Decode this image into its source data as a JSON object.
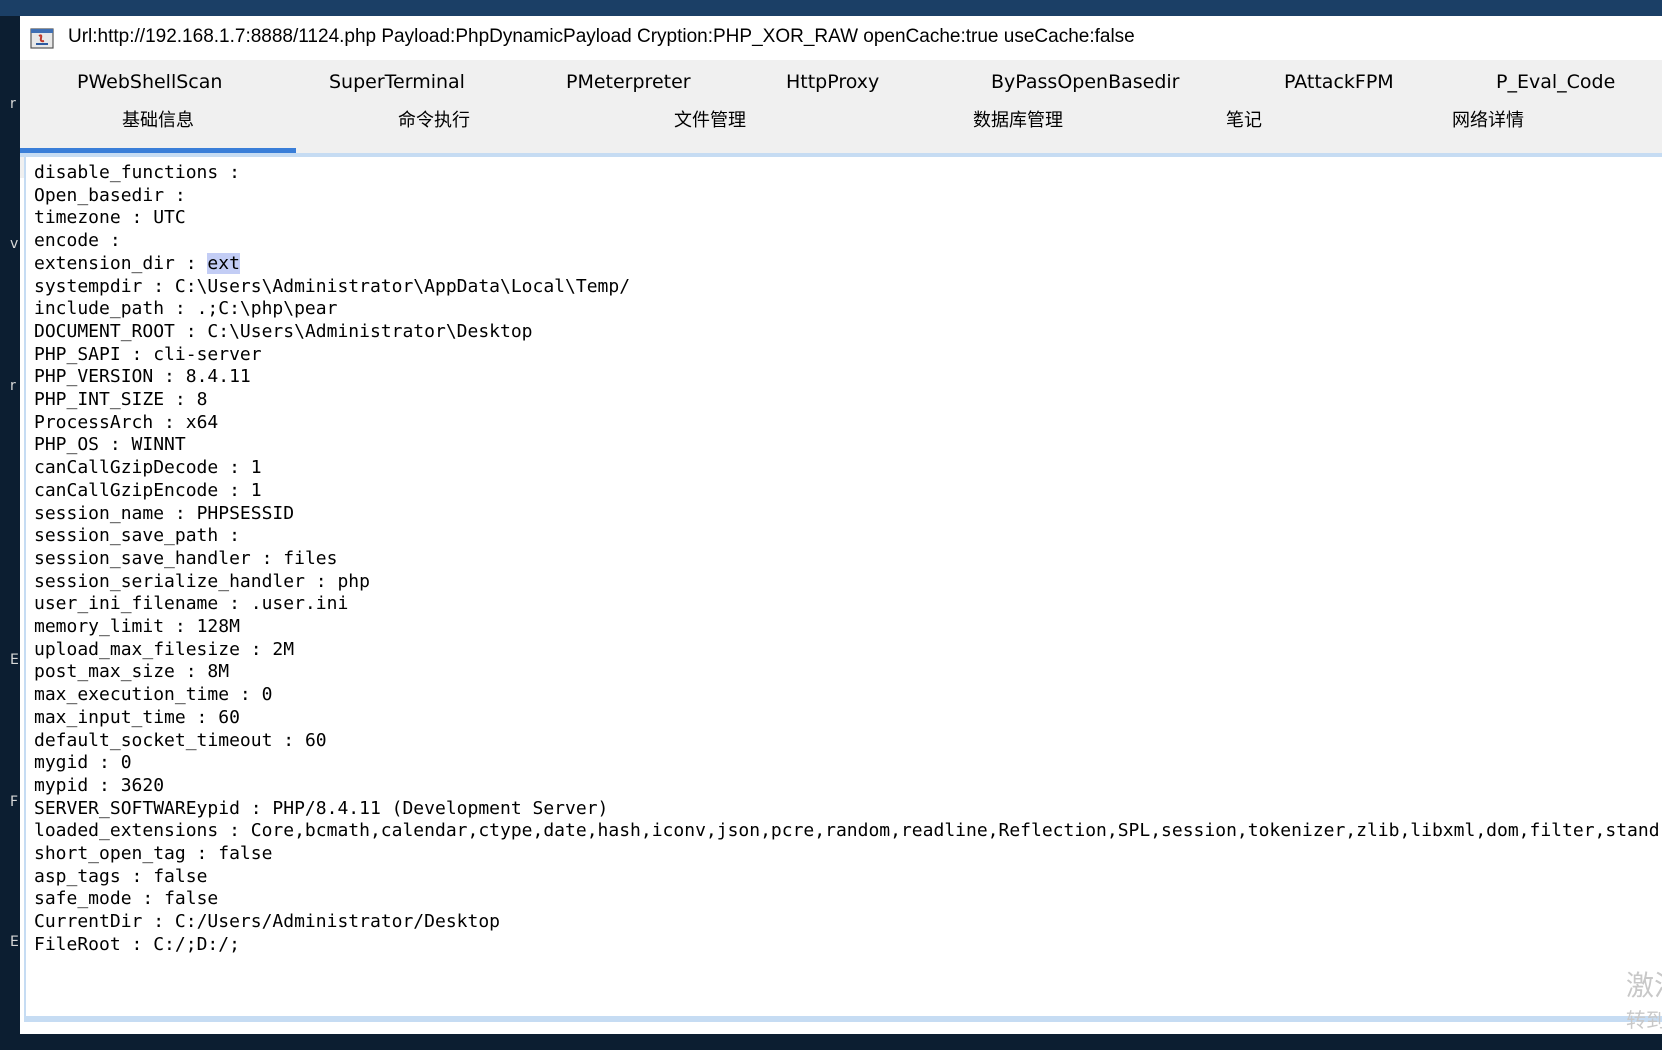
{
  "desktop": {
    "left_letters": [
      "r",
      "v",
      "r",
      "E",
      "F",
      "E"
    ]
  },
  "window": {
    "title": "Url:http://192.168.1.7:8888/1124.php Payload:PhpDynamicPayload Cryption:PHP_XOR_RAW openCache:true useCache:false",
    "icon": "java-app-icon"
  },
  "plugins": [
    "PWebShellScan",
    "SuperTerminal",
    "PMeterpreter",
    "HttpProxy",
    "ByPassOpenBasedir",
    "PAttackFPM",
    "P_Eval_Code"
  ],
  "tabs": [
    "基础信息",
    "命令执行",
    "文件管理",
    "数据库管理",
    "笔记",
    "网络详情"
  ],
  "active_tab": "基础信息",
  "info": [
    {
      "k": "disable_functions",
      "v": ""
    },
    {
      "k": "Open_basedir",
      "v": ""
    },
    {
      "k": "timezone",
      "v": "UTC"
    },
    {
      "k": "encode",
      "v": ""
    },
    {
      "k": "extension_dir",
      "v": "ext"
    },
    {
      "k": "systempdir",
      "v": "C:\\Users\\Administrator\\AppData\\Local\\Temp/"
    },
    {
      "k": "include_path",
      "v": ".;C:\\php\\pear"
    },
    {
      "k": "DOCUMENT_ROOT",
      "v": "C:\\Users\\Administrator\\Desktop"
    },
    {
      "k": "PHP_SAPI",
      "v": "cli-server"
    },
    {
      "k": "PHP_VERSION",
      "v": "8.4.11"
    },
    {
      "k": "PHP_INT_SIZE",
      "v": "8"
    },
    {
      "k": "ProcessArch",
      "v": "x64"
    },
    {
      "k": "PHP_OS",
      "v": "WINNT"
    },
    {
      "k": "canCallGzipDecode",
      "v": "1"
    },
    {
      "k": "canCallGzipEncode",
      "v": "1"
    },
    {
      "k": "session_name",
      "v": "PHPSESSID"
    },
    {
      "k": "session_save_path",
      "v": ""
    },
    {
      "k": "session_save_handler",
      "v": "files"
    },
    {
      "k": "session_serialize_handler",
      "v": "php"
    },
    {
      "k": "user_ini_filename",
      "v": ".user.ini"
    },
    {
      "k": "memory_limit",
      "v": "128M"
    },
    {
      "k": "upload_max_filesize",
      "v": "2M"
    },
    {
      "k": "post_max_size",
      "v": "8M"
    },
    {
      "k": "max_execution_time",
      "v": "0"
    },
    {
      "k": "max_input_time",
      "v": "60"
    },
    {
      "k": "default_socket_timeout",
      "v": "60"
    },
    {
      "k": "mygid",
      "v": "0"
    },
    {
      "k": "mypid",
      "v": "3620"
    },
    {
      "k": "SERVER_SOFTWAREypid",
      "v": "PHP/8.4.11 (Development Server)"
    },
    {
      "k": "loaded_extensions",
      "v": "Core,bcmath,calendar,ctype,date,hash,iconv,json,pcre,random,readline,Reflection,SPL,session,tokenizer,zlib,libxml,dom,filter,stand"
    },
    {
      "k": "short_open_tag",
      "v": "false"
    },
    {
      "k": "asp_tags",
      "v": "false"
    },
    {
      "k": "safe_mode",
      "v": "false"
    },
    {
      "k": "CurrentDir",
      "v": "C:/Users/Administrator/Desktop"
    },
    {
      "k": "FileRoot",
      "v": "C:/;D:/;"
    }
  ],
  "selected_text": "ext",
  "separator": " : ",
  "watermark": [
    "激活",
    "转到"
  ],
  "colors": {
    "tab_accent": "#3a7ed8",
    "selection": "#c3cdf5",
    "menu_bg": "#f0f0f0"
  }
}
